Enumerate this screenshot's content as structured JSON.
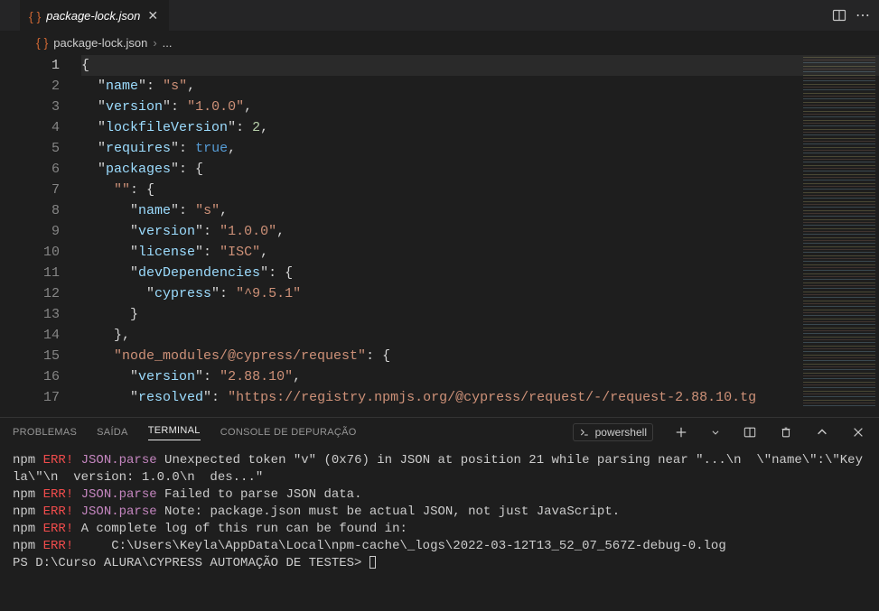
{
  "tab": {
    "filename": "package-lock.json",
    "close_glyph": "✕"
  },
  "breadcrumb": {
    "filename": "package-lock.json",
    "more": "..."
  },
  "editor_actions": {
    "more_glyph": "⋯"
  },
  "code": {
    "lines": [
      {
        "n": 1,
        "indent": 0,
        "current": true,
        "segs": [
          {
            "c": "tok-punc",
            "t": "{"
          }
        ]
      },
      {
        "n": 2,
        "indent": 1,
        "segs": [
          {
            "c": "tok-punc",
            "t": "\""
          },
          {
            "c": "tok-key",
            "t": "name"
          },
          {
            "c": "tok-punc",
            "t": "\": "
          },
          {
            "c": "tok-str",
            "t": "\"s\""
          },
          {
            "c": "tok-punc",
            "t": ","
          }
        ]
      },
      {
        "n": 3,
        "indent": 1,
        "segs": [
          {
            "c": "tok-punc",
            "t": "\""
          },
          {
            "c": "tok-key",
            "t": "version"
          },
          {
            "c": "tok-punc",
            "t": "\": "
          },
          {
            "c": "tok-str",
            "t": "\"1.0.0\""
          },
          {
            "c": "tok-punc",
            "t": ","
          }
        ]
      },
      {
        "n": 4,
        "indent": 1,
        "segs": [
          {
            "c": "tok-punc",
            "t": "\""
          },
          {
            "c": "tok-key",
            "t": "lockfileVersion"
          },
          {
            "c": "tok-punc",
            "t": "\": "
          },
          {
            "c": "tok-num",
            "t": "2"
          },
          {
            "c": "tok-punc",
            "t": ","
          }
        ]
      },
      {
        "n": 5,
        "indent": 1,
        "segs": [
          {
            "c": "tok-punc",
            "t": "\""
          },
          {
            "c": "tok-key",
            "t": "requires"
          },
          {
            "c": "tok-punc",
            "t": "\": "
          },
          {
            "c": "tok-bool",
            "t": "true"
          },
          {
            "c": "tok-punc",
            "t": ","
          }
        ]
      },
      {
        "n": 6,
        "indent": 1,
        "segs": [
          {
            "c": "tok-punc",
            "t": "\""
          },
          {
            "c": "tok-key",
            "t": "packages"
          },
          {
            "c": "tok-punc",
            "t": "\": {"
          }
        ]
      },
      {
        "n": 7,
        "indent": 2,
        "segs": [
          {
            "c": "tok-str",
            "t": "\"\""
          },
          {
            "c": "tok-punc",
            "t": ": {"
          }
        ]
      },
      {
        "n": 8,
        "indent": 3,
        "segs": [
          {
            "c": "tok-punc",
            "t": "\""
          },
          {
            "c": "tok-key",
            "t": "name"
          },
          {
            "c": "tok-punc",
            "t": "\": "
          },
          {
            "c": "tok-str",
            "t": "\"s\""
          },
          {
            "c": "tok-punc",
            "t": ","
          }
        ]
      },
      {
        "n": 9,
        "indent": 3,
        "segs": [
          {
            "c": "tok-punc",
            "t": "\""
          },
          {
            "c": "tok-key",
            "t": "version"
          },
          {
            "c": "tok-punc",
            "t": "\": "
          },
          {
            "c": "tok-str",
            "t": "\"1.0.0\""
          },
          {
            "c": "tok-punc",
            "t": ","
          }
        ]
      },
      {
        "n": 10,
        "indent": 3,
        "segs": [
          {
            "c": "tok-punc",
            "t": "\""
          },
          {
            "c": "tok-key",
            "t": "license"
          },
          {
            "c": "tok-punc",
            "t": "\": "
          },
          {
            "c": "tok-str",
            "t": "\"ISC\""
          },
          {
            "c": "tok-punc",
            "t": ","
          }
        ]
      },
      {
        "n": 11,
        "indent": 3,
        "segs": [
          {
            "c": "tok-punc",
            "t": "\""
          },
          {
            "c": "tok-key",
            "t": "devDependencies"
          },
          {
            "c": "tok-punc",
            "t": "\": {"
          }
        ]
      },
      {
        "n": 12,
        "indent": 4,
        "segs": [
          {
            "c": "tok-punc",
            "t": "\""
          },
          {
            "c": "tok-key",
            "t": "cypress"
          },
          {
            "c": "tok-punc",
            "t": "\": "
          },
          {
            "c": "tok-str",
            "t": "\"^9.5.1\""
          }
        ]
      },
      {
        "n": 13,
        "indent": 3,
        "segs": [
          {
            "c": "tok-punc",
            "t": "}"
          }
        ]
      },
      {
        "n": 14,
        "indent": 2,
        "segs": [
          {
            "c": "tok-punc",
            "t": "},"
          }
        ]
      },
      {
        "n": 15,
        "indent": 2,
        "segs": [
          {
            "c": "tok-str",
            "t": "\"node_modules/@cypress/request\""
          },
          {
            "c": "tok-punc",
            "t": ": {"
          }
        ]
      },
      {
        "n": 16,
        "indent": 3,
        "segs": [
          {
            "c": "tok-punc",
            "t": "\""
          },
          {
            "c": "tok-key",
            "t": "version"
          },
          {
            "c": "tok-punc",
            "t": "\": "
          },
          {
            "c": "tok-str",
            "t": "\"2.88.10\""
          },
          {
            "c": "tok-punc",
            "t": ","
          }
        ]
      },
      {
        "n": 17,
        "indent": 3,
        "segs": [
          {
            "c": "tok-punc",
            "t": "\""
          },
          {
            "c": "tok-key",
            "t": "resolved"
          },
          {
            "c": "tok-punc",
            "t": "\": "
          },
          {
            "c": "tok-str",
            "t": "\"https://registry.npmjs.org/@cypress/request/-/request-2.88.10.tg"
          }
        ]
      }
    ]
  },
  "panel": {
    "tabs": {
      "problems": "PROBLEMAS",
      "output": "SAÍDA",
      "terminal": "TERMINAL",
      "debug": "CONSOLE DE DEPURAÇÃO"
    },
    "shell_label": "powershell"
  },
  "terminal": {
    "lines": [
      [
        {
          "c": "t-norm",
          "t": "npm "
        },
        {
          "c": "t-err",
          "t": "ERR!"
        },
        {
          "c": "t-norm",
          "t": " "
        },
        {
          "c": "t-mod",
          "t": "JSON.parse"
        },
        {
          "c": "t-norm",
          "t": " Unexpected token \"v\" (0x76) in JSON at position 21 while parsing near \"...\\n  \\\"name\\\":\\\"Keyla\\\"\\n  version: 1.0.0\\n  des...\""
        }
      ],
      [
        {
          "c": "t-norm",
          "t": "npm "
        },
        {
          "c": "t-err",
          "t": "ERR!"
        },
        {
          "c": "t-norm",
          "t": " "
        },
        {
          "c": "t-mod",
          "t": "JSON.parse"
        },
        {
          "c": "t-norm",
          "t": " Failed to parse JSON data."
        }
      ],
      [
        {
          "c": "t-norm",
          "t": "npm "
        },
        {
          "c": "t-err",
          "t": "ERR!"
        },
        {
          "c": "t-norm",
          "t": " "
        },
        {
          "c": "t-mod",
          "t": "JSON.parse"
        },
        {
          "c": "t-norm",
          "t": " Note: package.json must be actual JSON, not just JavaScript."
        }
      ],
      [
        {
          "c": "t-norm",
          "t": ""
        }
      ],
      [
        {
          "c": "t-norm",
          "t": "npm "
        },
        {
          "c": "t-err",
          "t": "ERR!"
        },
        {
          "c": "t-norm",
          "t": " A complete log of this run can be found in:"
        }
      ],
      [
        {
          "c": "t-norm",
          "t": "npm "
        },
        {
          "c": "t-err",
          "t": "ERR!"
        },
        {
          "c": "t-norm",
          "t": "     C:\\Users\\Keyla\\AppData\\Local\\npm-cache\\_logs\\2022-03-12T13_52_07_567Z-debug-0.log"
        }
      ]
    ],
    "prompt": "PS D:\\Curso ALURA\\CYPRESS AUTOMAÇÃO DE TESTES> "
  }
}
